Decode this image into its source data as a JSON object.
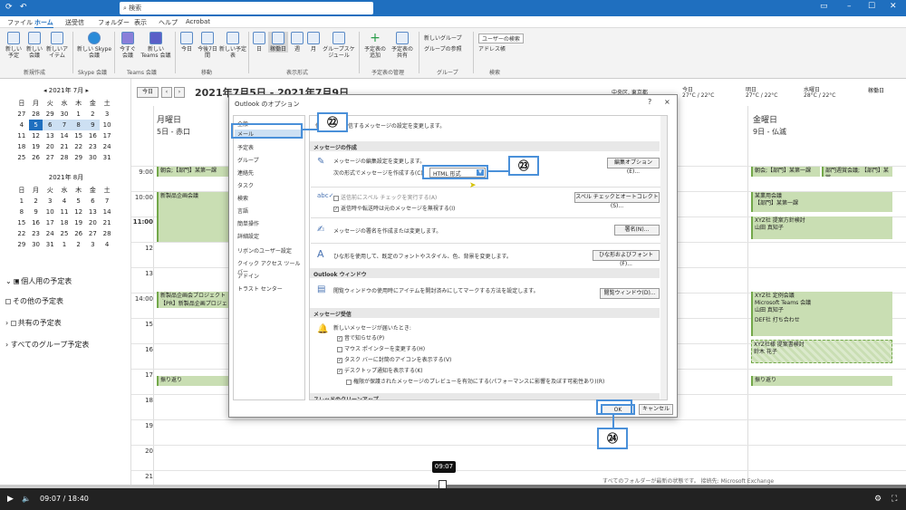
{
  "titlebar": {
    "search_placeholder": "検索"
  },
  "menu": [
    "ファイル",
    "ホーム",
    "送受信",
    "フォルダー",
    "表示",
    "ヘルプ",
    "Acrobat"
  ],
  "ribbon": {
    "buttons": [
      "新しい予定",
      "新しい会議",
      "新しいアイテム",
      "新しい Skype 会議",
      "今すぐ会議",
      "新しい Teams 会議",
      "今日",
      "今後7日間",
      "新しい予定表",
      "日",
      "稼働日",
      "週",
      "月",
      "グループスケジュール",
      "予定表の追加",
      "予定表の共有",
      "新しいグループ",
      "グループの参照",
      "ユーザーの検索",
      "アドレス帳"
    ],
    "groups": [
      "新規作成",
      "Skype 会議",
      "Teams 会議",
      "移動",
      "表示形式",
      "予定表の管理",
      "グループ",
      "検索"
    ]
  },
  "left": {
    "jul_title": "2021年 7月",
    "aug_title": "2021年 8月",
    "weekdays": [
      "日",
      "月",
      "火",
      "水",
      "木",
      "金",
      "土"
    ],
    "folders": [
      "個人用の予定表",
      "その他の予定表",
      "共有の予定表",
      "すべてのグループ予定表"
    ]
  },
  "calendar": {
    "today_btn": "今日",
    "range": "2021年7月5日 - 2021年7月9日",
    "location": "中央区, 東京都",
    "weather": [
      "今日",
      "明日",
      "水曜日"
    ],
    "temps": [
      "27°C / 22°C",
      "27°C / 22°C",
      "28°C / 22°C"
    ],
    "view_btn": "稼働日",
    "day_mon": "月曜日",
    "date_mon": "5日 - 赤口",
    "day_fri": "金曜日",
    "date_fri": "9日 - 仏滅",
    "hours": [
      "9:00",
      "10:00",
      "11:00",
      "12",
      "13",
      "14:00",
      "15",
      "16",
      "17",
      "18",
      "19",
      "20",
      "21"
    ],
    "ev_mon": [
      "朝会;【部門】某第一課",
      "新製品企画会議",
      "新製品企画会プロジェクト 定例",
      "【PR】新製品企画プロジェクト",
      "振り返り"
    ],
    "ev_fri": [
      "朝会;【部門】某第一課",
      "部門週賞会議; 【部門】某賞",
      "某業用会議",
      "【部門】某第一課",
      "XYZ社 提案方針検討",
      "山田 真知子",
      "XYZ社 定例会議",
      "Microsoft Teams 会議",
      "山田 真知子",
      "DEF社 打ち合わせ",
      "XYZ社様 提案書検討",
      "鈴木 花子",
      "振り返り"
    ]
  },
  "dialog": {
    "title": "Outlook のオプション",
    "help": "?",
    "close": "×",
    "nav": [
      "全般",
      "メール",
      "予定表",
      "グループ",
      "連絡先",
      "タスク",
      "検索",
      "言語",
      "簡単操作",
      "詳細設定",
      "リボンのユーザー設定",
      "クイック アクセス ツール バー",
      "アドイン",
      "トラスト センター"
    ],
    "header": "作成および受信するメッセージの設定を変更します。",
    "sec_compose": "メッセージの作成",
    "compose_desc": "メッセージの編集設定を変更します。",
    "format_label": "次の形式でメッセージを作成する(C):",
    "format_value": "HTML 形式",
    "editor_btn": "編集オプション(E)...",
    "spell_chk1": "送信前にスペル チェックを実行する(A)",
    "spell_chk2": "返信時や転送時は元のメッセージを無視する(I)",
    "spell_btn": "スペル チェックとオートコレクト(S)...",
    "sig_desc": "メッセージの署名を作成または変更します。",
    "sig_btn": "署名(N)...",
    "font_desc": "ひな形を使用して、既定のフォントやスタイル、色、背景を変更します。",
    "font_btn": "ひな形およびフォント(F)...",
    "sec_reading": "Outlook ウィンドウ",
    "reading_desc": "閲覧ウィンドウの使用時にアイテムを開封済みにしてマークする方法を設定します。",
    "reading_btn": "閲覧ウィンドウ(D)...",
    "sec_arrival": "メッセージ受信",
    "arrival_desc": "新しいメッセージが届いたとき:",
    "arr1": "音で知らせる(P)",
    "arr2": "マウス ポインターを変更する(H)",
    "arr3": "タスク バーに封筒のアイコンを表示する(V)",
    "arr4": "デスクトップ通知を表示する(K)",
    "arr5": "権限が保護されたメッセージのプレビューを有効にする(パフォーマンスに影響を及ぼす可能性あり)(R)",
    "sec_cleanup": "スレッドのクリーンアップ",
    "ok": "OK",
    "cancel": "キャンセル"
  },
  "badges": [
    "㉒",
    "㉓",
    "㉔"
  ],
  "video": {
    "time": "09:07 / 18:40",
    "tooltip": "09:07",
    "status": "すべてのフォルダーが最新の状態です。 接続先: Microsoft Exchange"
  }
}
